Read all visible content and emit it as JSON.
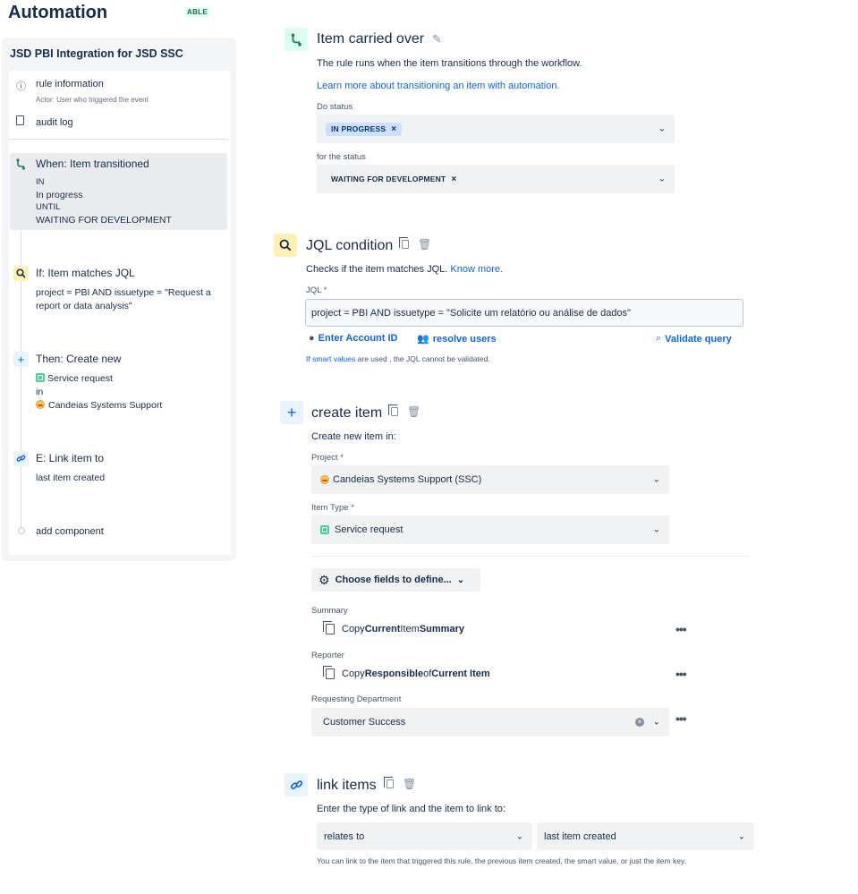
{
  "header": {
    "title": "Automation",
    "badge": "ABLE"
  },
  "sidebar": {
    "rule_name": "JSD PBI Integration for JSD SSC",
    "rule_information": "rule information",
    "actor": "Actor: User who triggered the event",
    "audit_log": "audit log",
    "steps": [
      {
        "title": "When: Item transitioned",
        "lines": [
          "IN",
          "In progress",
          "UNTIL",
          "WAITING FOR DEVELOPMENT"
        ]
      },
      {
        "title": "If: Item matches JQL",
        "lines": [
          "project = PBI AND issuetype = \"Request a",
          "report or data analysis\""
        ]
      },
      {
        "title": "Then: Create new",
        "lines": [
          "Service request",
          "in",
          "Candeias Systems Support"
        ]
      },
      {
        "title": "E: Link item to",
        "lines": [
          "last item created"
        ]
      }
    ],
    "add_component": "add component"
  },
  "trigger": {
    "title": "Item carried over",
    "description": "The rule runs when the item transitions through the workflow.",
    "learn_link": "Learn more about transitioning an item with automation.",
    "from_label": "Do status",
    "from_value": "IN PROGRESS",
    "to_label": "for the status",
    "to_value": "WAITING FOR DEVELOPMENT"
  },
  "condition": {
    "title": "JQL condition",
    "description": "Checks if the item matches JQL.",
    "know_more": "Know more.",
    "jql_label": "JQL",
    "required_mark": "*",
    "jql_value": "project = PBI AND issuetype = \"Solicite um relatório ou análise de dados\"",
    "enter_account_id": "Enter Account ID",
    "resolve_users": "resolve users",
    "validate_query": "Validate query",
    "smart_values_link": "If smart values",
    "smart_values_rest": " are used , the JQL cannot be validated."
  },
  "create": {
    "title": "create item",
    "subtitle": "Create new item in:",
    "project_label": "Project",
    "project_value": "Candeias Systems Support (SSC)",
    "type_label": "Item Type",
    "type_value": "Service request",
    "choose_fields": "Choose fields to define...",
    "summary_label": "Summary",
    "summary_parts": [
      "Copy ",
      "Current",
      " Item ",
      "Summary"
    ],
    "reporter_label": "Reporter",
    "reporter_parts": [
      "Copy ",
      "Responsible",
      " of ",
      "Current Item"
    ],
    "dept_label": "Requesting Department",
    "dept_value": "Customer Success",
    "more": "•••"
  },
  "link": {
    "title": "link items",
    "description": "Enter the type of link and the item to link to:",
    "link_type": "relates to",
    "link_target": "last item created",
    "help": "You can link to the item that triggered this rule, the previous item created, the smart value, or just the item key."
  },
  "colors": {
    "accent": "#0c66e4",
    "text": "#172b4d",
    "panel": "#f4f5f7"
  },
  "icons": [
    "transition-icon",
    "search-icon",
    "plus-icon",
    "link-icon",
    "copy-icon",
    "trash-icon",
    "gear-icon",
    "chevron-down-icon",
    "edit-icon"
  ]
}
